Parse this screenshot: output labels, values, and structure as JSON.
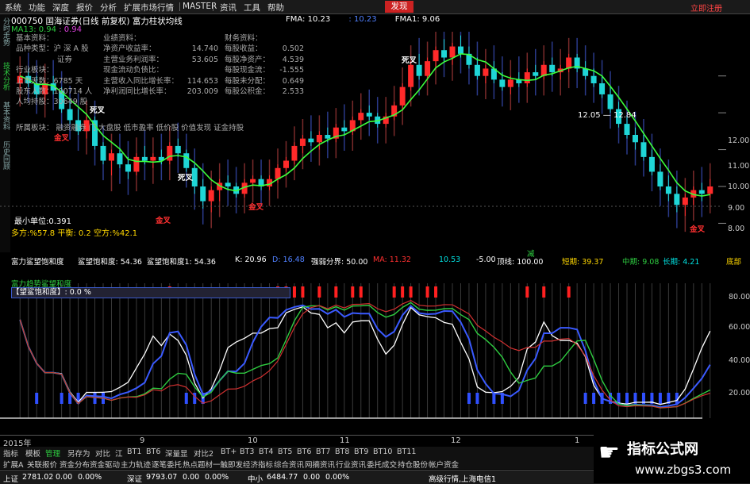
{
  "menubar": {
    "items": [
      "系统",
      "功能",
      "深度",
      "报价",
      "分析",
      "扩展市场行情",
      "MASTER",
      "资讯",
      "工具",
      "帮助"
    ],
    "discover": "发现",
    "brand": "立即注册"
  },
  "left_tabs": [
    "分时走势",
    "技术分析",
    "基本资料",
    "历史回顾"
  ],
  "header": {
    "code": "000750",
    "name": "国海证券(日线 前复权)",
    "indicator": "富力柱状均线",
    "fma_label": "FMA: 10.23",
    "fma_val": ": 10.23",
    "fma1_label": "FMA1: 9.06",
    "ma_label": "MA13: 0.94",
    "ma_val": ": 0.94"
  },
  "fund": {
    "col1_title": "基本资料：",
    "col1": [
      [
        "品种类型：",
        "沪 深 A 股"
      ],
      [
        "",
        "证券"
      ],
      [
        "行业板块：",
        ""
      ],
      [
        "上市天数：",
        "6785 天"
      ],
      [
        "股东人数：",
        "100714 人"
      ],
      [
        "人均持股：",
        "30649 股"
      ]
    ],
    "col2_title": "业绩资料：",
    "col2": [
      [
        "净资产收益率：",
        "14.740"
      ],
      [
        "主营业务利润率：",
        "53.605"
      ],
      [
        "现金流动负债比：",
        ""
      ],
      [
        "主营收入同比增长率：",
        "114.653"
      ],
      [
        "净利润同比增长率：",
        "203.009"
      ]
    ],
    "col3_title": "财务资料：",
    "col3": [
      [
        "每股收益：",
        "0.502"
      ],
      [
        "每股净资产：",
        "4.539"
      ],
      [
        "每股现金流：",
        "-1.555"
      ],
      [
        "每股未分配：",
        "0.649"
      ],
      [
        "每股公积金：",
        "2.533"
      ]
    ],
    "sector_label": "所属板块：",
    "sectors": "融资融券  门  大盘股  低市盈率  低价股  价值发现  证金持股"
  },
  "annotations": {
    "dead_cross": "死叉",
    "gold_cross": "金叉",
    "price_range": "12.05 — 12.84"
  },
  "main_info": {
    "min_unit": "最小单位:0.391",
    "duo_label": "多方:",
    "duo_val": "%57.8",
    "ping_label": "平衡: 0.2",
    "kong_label": "空方:",
    "kong_val": "%42.1"
  },
  "y_axis_main": [
    "12.00",
    "11.00",
    "10.00",
    "9.00",
    "8.00"
  ],
  "y_axis_sub": [
    "80.00",
    "60.00",
    "40.00",
    "20.00"
  ],
  "indicator_row": {
    "name": "富力鲨望饱和度",
    "v1": "鲨望饱和度: 54.36",
    "v2": "鲨望饱和度1: 54.36",
    "k": "K: 20.96",
    "d": "D: 16.48",
    "j": "J: 11.32",
    "strong_label": "强弱分界: 50.00",
    "mid": "MA: 11.32",
    "up": "10.53",
    "dn": "-5.00",
    "top": "顶线: 100.00",
    "short": "短期: 39.37",
    "mid2": "中期: 9.08",
    "long": "长期: 4.21",
    "bottom": "底部",
    "center": "减"
  },
  "indicator2": {
    "line1": "富力趋势鲨望和度",
    "bar_label": "【望鲨饱和度】: 0.0 %"
  },
  "time_axis": [
    {
      "label": "2015年"
    },
    {
      "label": "9"
    },
    {
      "label": "10"
    },
    {
      "label": "11"
    },
    {
      "label": "12"
    },
    {
      "label": "1"
    }
  ],
  "tabs1": [
    "指标",
    "模板",
    "管理",
    "另存为",
    "对比",
    "江",
    "BT1",
    "BT6",
    "深量显",
    "对比2",
    "BT+",
    "BT3",
    "BT4",
    "BT5",
    "BT6",
    "BT7",
    "BT8",
    "BT9",
    "BT10",
    "BT11"
  ],
  "tabs1_active": "管理",
  "tabs2": [
    "扩展A",
    "关联报价",
    "资金分布",
    "资金驱动",
    "主力轨迹",
    "逐笔委托",
    "热点题材",
    "一触即发",
    "经济指标",
    "综合资讯",
    "网摘资讯",
    "行业资讯",
    "委托成交",
    "持仓股份",
    "帐户资金"
  ],
  "status": {
    "sh_label": "上证",
    "sh_val": "2781.02",
    "sh_chg": "0.00",
    "sh_pct": "0.00%",
    "sz_label": "深证",
    "sz_val": "9793.07",
    "sz_chg": "0.00",
    "sz_pct": "0.00%",
    "zx_label": "中小",
    "zx_val": "6484.77",
    "zx_chg": "0.00",
    "zx_pct": "0.00%",
    "feed": "高级行情,上海电信1"
  },
  "watermark": {
    "title": "指标公式网",
    "url": "www.zbgs3.com",
    "site": "www.zbgs3.com"
  },
  "chart_data": {
    "type": "candlestick",
    "ylim": [
      7.6,
      13.2
    ],
    "candles": [
      [
        11.8,
        12.1,
        11.6,
        12.0
      ],
      [
        12.0,
        12.2,
        11.7,
        11.8
      ],
      [
        11.8,
        12.0,
        11.4,
        11.5
      ],
      [
        11.5,
        11.9,
        11.3,
        11.8
      ],
      [
        11.8,
        12.0,
        11.5,
        11.6
      ],
      [
        11.6,
        11.7,
        11.0,
        11.1
      ],
      [
        11.1,
        11.3,
        10.7,
        10.8
      ],
      [
        10.8,
        11.1,
        10.4,
        10.5
      ],
      [
        10.5,
        10.9,
        10.3,
        10.8
      ],
      [
        10.8,
        10.9,
        10.0,
        10.1
      ],
      [
        10.1,
        10.2,
        9.6,
        9.7
      ],
      [
        9.7,
        10.0,
        9.3,
        9.9
      ],
      [
        9.9,
        10.0,
        9.5,
        9.6
      ],
      [
        9.6,
        9.8,
        9.2,
        9.4
      ],
      [
        9.4,
        9.9,
        9.3,
        9.8
      ],
      [
        9.8,
        10.1,
        9.6,
        9.7
      ],
      [
        9.7,
        9.9,
        9.5,
        9.8
      ],
      [
        9.8,
        10.0,
        9.6,
        9.7
      ],
      [
        9.7,
        10.2,
        9.6,
        10.1
      ],
      [
        10.1,
        10.3,
        9.8,
        9.9
      ],
      [
        9.9,
        10.0,
        9.4,
        9.5
      ],
      [
        9.5,
        9.6,
        8.8,
        9.0
      ],
      [
        9.0,
        9.2,
        8.4,
        8.6
      ],
      [
        8.6,
        9.0,
        8.3,
        8.9
      ],
      [
        8.9,
        9.2,
        8.6,
        9.1
      ],
      [
        9.1,
        9.3,
        8.9,
        9.0
      ],
      [
        9.0,
        9.1,
        8.7,
        8.8
      ],
      [
        8.8,
        9.2,
        8.7,
        9.1
      ],
      [
        9.1,
        9.3,
        9.0,
        9.2
      ],
      [
        9.2,
        9.3,
        8.9,
        9.0
      ],
      [
        9.0,
        9.3,
        8.9,
        9.2
      ],
      [
        9.2,
        9.6,
        9.1,
        9.5
      ],
      [
        9.5,
        9.8,
        9.4,
        9.7
      ],
      [
        9.7,
        10.2,
        9.6,
        10.1
      ],
      [
        10.1,
        10.4,
        9.9,
        10.3
      ],
      [
        10.3,
        10.5,
        10.1,
        10.2
      ],
      [
        10.2,
        10.5,
        10.0,
        10.4
      ],
      [
        10.4,
        10.6,
        10.2,
        10.3
      ],
      [
        10.3,
        10.7,
        10.2,
        10.6
      ],
      [
        10.6,
        10.8,
        10.4,
        10.5
      ],
      [
        10.5,
        10.9,
        10.4,
        10.8
      ],
      [
        10.8,
        11.1,
        10.7,
        11.0
      ],
      [
        11.0,
        11.2,
        10.8,
        10.9
      ],
      [
        10.9,
        11.0,
        10.6,
        10.7
      ],
      [
        10.7,
        11.0,
        10.6,
        10.9
      ],
      [
        10.9,
        11.3,
        10.8,
        11.2
      ],
      [
        11.2,
        11.8,
        11.1,
        11.7
      ],
      [
        11.7,
        12.4,
        11.6,
        12.3
      ],
      [
        12.3,
        12.6,
        11.9,
        12.0
      ],
      [
        12.0,
        12.5,
        11.9,
        12.4
      ],
      [
        12.4,
        12.8,
        12.2,
        12.7
      ],
      [
        12.7,
        13.0,
        12.4,
        12.5
      ],
      [
        12.5,
        12.9,
        12.3,
        12.8
      ],
      [
        12.8,
        13.1,
        12.5,
        12.6
      ],
      [
        12.6,
        12.8,
        12.2,
        12.3
      ],
      [
        12.3,
        12.5,
        11.9,
        12.0
      ],
      [
        12.0,
        12.3,
        11.8,
        12.2
      ],
      [
        12.2,
        12.4,
        11.8,
        11.9
      ],
      [
        11.9,
        12.1,
        11.6,
        11.7
      ],
      [
        11.7,
        12.0,
        11.5,
        11.9
      ],
      [
        11.9,
        12.1,
        11.7,
        11.8
      ],
      [
        11.8,
        12.2,
        11.7,
        12.1
      ],
      [
        12.1,
        12.3,
        11.9,
        12.0
      ],
      [
        12.0,
        12.4,
        11.9,
        12.3
      ],
      [
        12.3,
        12.5,
        12.0,
        12.1
      ],
      [
        12.1,
        12.3,
        11.9,
        12.2
      ],
      [
        12.2,
        12.6,
        12.1,
        12.5
      ],
      [
        12.5,
        12.6,
        12.1,
        12.2
      ],
      [
        12.2,
        12.4,
        11.9,
        12.0
      ],
      [
        12.0,
        12.2,
        11.7,
        11.8
      ],
      [
        11.8,
        12.0,
        11.4,
        11.5
      ],
      [
        11.5,
        11.7,
        11.0,
        11.1
      ],
      [
        11.1,
        11.3,
        10.6,
        10.7
      ],
      [
        10.7,
        10.9,
        10.3,
        10.4
      ],
      [
        10.4,
        10.6,
        10.0,
        10.2
      ],
      [
        10.2,
        10.4,
        9.7,
        9.8
      ],
      [
        9.8,
        10.0,
        9.3,
        9.4
      ],
      [
        9.4,
        9.6,
        8.9,
        9.0
      ],
      [
        9.0,
        9.3,
        8.6,
        8.8
      ],
      [
        8.8,
        9.0,
        8.3,
        8.5
      ],
      [
        8.5,
        8.8,
        8.2,
        8.7
      ],
      [
        8.7,
        9.0,
        8.5,
        8.9
      ],
      [
        8.9,
        9.1,
        8.6,
        8.8
      ],
      [
        8.8,
        9.2,
        8.7,
        9.0
      ]
    ]
  }
}
